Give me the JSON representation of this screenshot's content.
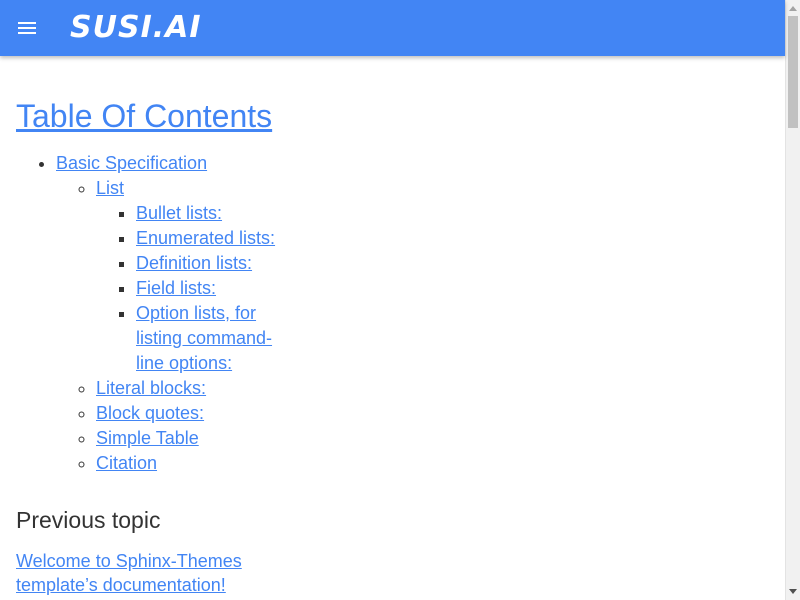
{
  "header": {
    "logo_text": "SUSI.AI",
    "menu_icon": "hamburger-menu-icon",
    "background_color": "#4285f4"
  },
  "toc": {
    "title": "Table Of Contents",
    "items": [
      {
        "label": "Basic Specification",
        "children": [
          {
            "label": "List",
            "children": [
              {
                "label": "Bullet lists:"
              },
              {
                "label": "Enumerated lists:"
              },
              {
                "label": "Definition lists:"
              },
              {
                "label": "Field lists:"
              },
              {
                "label": "Option lists, for listing command-line options:"
              }
            ]
          },
          {
            "label": "Literal blocks:"
          },
          {
            "label": "Block quotes:"
          },
          {
            "label": "Simple Table"
          },
          {
            "label": "Citation"
          }
        ]
      }
    ]
  },
  "previous_topic": {
    "title": "Previous topic",
    "link_text": "Welcome to Sphinx-Themes template’s documentation!"
  },
  "colors": {
    "link": "#4285f4",
    "text": "#333333"
  }
}
